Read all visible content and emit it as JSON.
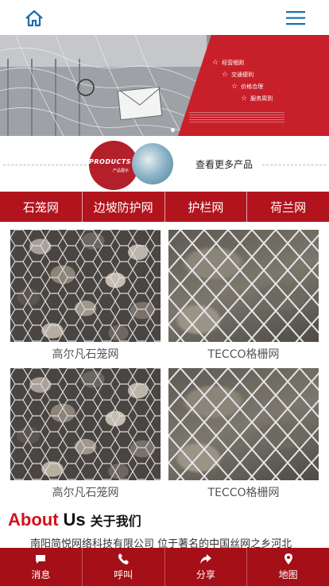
{
  "header": {
    "home_icon": "home-icon",
    "menu_icon": "menu-icon",
    "icon_color": "#1a6fa8"
  },
  "banner": {
    "features": [
      "经营细则",
      "交通便利",
      "价格合理",
      "服务周到"
    ],
    "brand_color": "#c8202a"
  },
  "products_strip": {
    "badge_word": "PRODUCTS",
    "badge_sub": "产品展示",
    "more_label": "查看更多产品"
  },
  "tabs": [
    {
      "label": "石笼网"
    },
    {
      "label": "边坡防护网"
    },
    {
      "label": "护栏网"
    },
    {
      "label": "荷兰网"
    }
  ],
  "products": [
    {
      "caption": "高尔凡石笼网",
      "image": "stone-gabion-image"
    },
    {
      "caption": "TECCO格栅网",
      "image": "tecco-mesh-image"
    },
    {
      "caption": "高尔凡石笼网",
      "image": "stone-gabion-image"
    },
    {
      "caption": "TECCO格栅网",
      "image": "tecco-mesh-image"
    }
  ],
  "about": {
    "title_red": "About",
    "title_dark": "Us",
    "title_cn": "关于我们",
    "text": "南阳简悦网络科技有限公司 位于著名的中国丝网之乡河北"
  },
  "bottom_nav": [
    {
      "label": "消息",
      "icon": "message-icon"
    },
    {
      "label": "呼叫",
      "icon": "phone-icon"
    },
    {
      "label": "分享",
      "icon": "share-icon"
    },
    {
      "label": "地图",
      "icon": "map-pin-icon"
    }
  ],
  "colors": {
    "primary_red": "#b1141d",
    "nav_red": "#a50f17",
    "accent_red": "#d0121b"
  }
}
